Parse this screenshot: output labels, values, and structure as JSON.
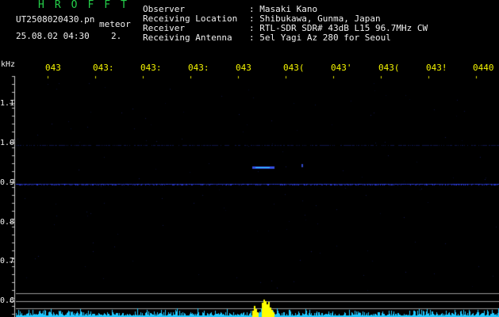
{
  "header": {
    "brand": "HROFFT",
    "filename": "UT2508020430.pn",
    "detection_label": "meteor",
    "timestamp": "25.08.02 04:30",
    "chevron": "2."
  },
  "info": [
    {
      "label": "Observer",
      "value": ": Masaki Kano"
    },
    {
      "label": "Receiving Location",
      "value": ": Shibukawa, Gunma, Japan"
    },
    {
      "label": "Receiver",
      "value": ": RTL-SDR SDR# 43dB L15 96.7MHz CW"
    },
    {
      "label": "Receiving Antenna",
      "value": ": 5el Yagi Az 280 for Seoul"
    }
  ],
  "axis": {
    "unit": "kHz",
    "time_labels": [
      "043",
      "043:",
      "043:",
      "043:",
      "043",
      "043(",
      "043'",
      "043(",
      "043!",
      "0440"
    ],
    "freq_labels": [
      "1.1",
      "1.0",
      "0.9",
      "0.8",
      "0.7",
      "0.6"
    ]
  },
  "colors": {
    "background": "#000000",
    "label_green": "#25d04a",
    "time_yellow": "#f4f400",
    "signal_blue": "#2a3cff",
    "signal_cyan": "#30d8ff",
    "echo_yellow": "#ffff00",
    "grid_gray": "#9a9a9a"
  }
}
